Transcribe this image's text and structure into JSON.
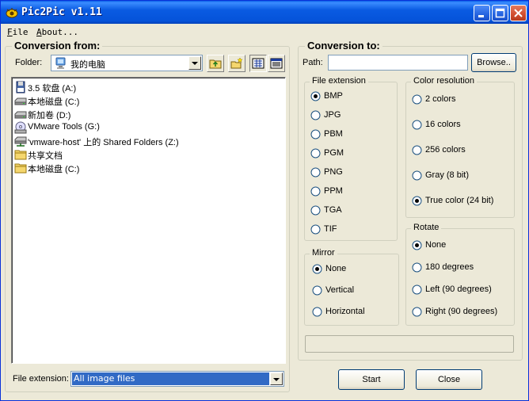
{
  "window": {
    "title": "Pic2Pic v1.11"
  },
  "colors": {
    "titlebar": "#0a5be2",
    "selection": "#316ac5",
    "face": "#ece9d8"
  },
  "menu": {
    "file": "File",
    "file_mnemonic": "F",
    "file_rest": "ile",
    "about": "About...",
    "about_mnemonic": "A",
    "about_rest": "bout..."
  },
  "left": {
    "title": "Conversion from:",
    "folder_label": "Folder:",
    "folder_value": "我的电脑",
    "tree": [
      {
        "label": "3.5 软盘 (A:)",
        "icon": "floppy-icon"
      },
      {
        "label": "本地磁盘 (C:)",
        "icon": "hard-drive-icon"
      },
      {
        "label": "新加卷 (D:)",
        "icon": "hard-drive-icon"
      },
      {
        "label": "VMware Tools (G:)",
        "icon": "cd-drive-icon"
      },
      {
        "label": "'vmware-host' 上的 Shared Folders (Z:)",
        "icon": "network-drive-icon"
      },
      {
        "label": "共享文档",
        "icon": "folder-icon"
      },
      {
        "label": "本地磁盘 (C:)",
        "icon": "folder-icon"
      }
    ],
    "file_ext_label": "File extension:",
    "file_ext_value": "All image files"
  },
  "right": {
    "title": "Conversion to:",
    "path_label": "Path:",
    "path_value": "",
    "browse": "Browse..",
    "file_extension": {
      "title": "File extension",
      "options": [
        "BMP",
        "JPG",
        "PBM",
        "PGM",
        "PNG",
        "PPM",
        "TGA",
        "TIF"
      ],
      "selected": 0
    },
    "color_resolution": {
      "title": "Color resolution",
      "options": [
        "2 colors",
        "16 colors",
        "256 colors",
        "Gray (8 bit)",
        "True color (24 bit)"
      ],
      "selected": 4
    },
    "mirror": {
      "title": "Mirror",
      "options": [
        "None",
        "Vertical",
        "Horizontal"
      ],
      "selected": 0
    },
    "rotate": {
      "title": "Rotate",
      "options": [
        "None",
        "180 degrees",
        "Left (90 degrees)",
        "Right (90 degrees)"
      ],
      "selected": 0
    },
    "progress": 0
  },
  "buttons": {
    "start": "Start",
    "close": "Close"
  }
}
